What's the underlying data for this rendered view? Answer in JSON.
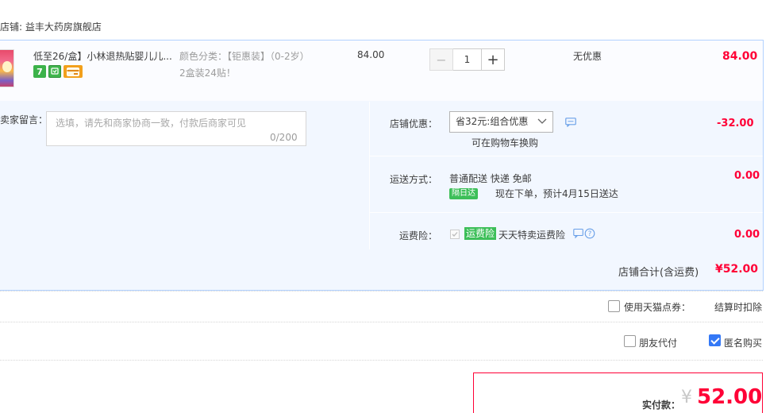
{
  "store": {
    "name_label": "店铺: 益丰大药房旗舰店"
  },
  "item": {
    "title": "低至26/盒】小林退热贴婴儿儿...",
    "badge_icons": [
      "tmall-7day-return-icon",
      "service-guarantee-icon",
      "card-payment-icon"
    ],
    "badge_seven_text": "7",
    "sku_line1": "颜色分类：【钜惠装】（0-2岁）",
    "sku_line2": "2盒装24贴！",
    "unit_price": "84.00",
    "quantity": "1",
    "qty_minus": "−",
    "qty_plus": "+",
    "discount_text": "无优惠",
    "subtotal": "84.00"
  },
  "message": {
    "label": "卖家留言：",
    "placeholder": "选填，请先和商家协商一致，付款后商家可见",
    "counter": "0/200"
  },
  "store_discount": {
    "label": "店铺优惠：",
    "selected": "省32元:组合优惠",
    "cart_swap": "可在购物车换购",
    "amount": "-32.00"
  },
  "shipping": {
    "label": "运送方式：",
    "method": "普通配送 快递 免邮",
    "next_day_badge": "隔日达",
    "eta": "现在下单，预计4月15日送达",
    "amount": "0.00"
  },
  "insurance": {
    "label": "运费险：",
    "badge": "运费险",
    "text": "天天特卖运费险",
    "amount": "0.00"
  },
  "store_total": {
    "label": "店铺合计(含运费)",
    "amount": "¥52.00"
  },
  "options": {
    "coupon_label": "使用天猫点券：",
    "settle_label": "结算时扣除",
    "friend_pay_label": "朋友代付",
    "anonymous_label": "匿名购买",
    "anonymous_checked": true,
    "friend_pay_checked": false,
    "coupon_checked": false
  },
  "payment": {
    "label": "实付款：",
    "currency": "¥",
    "amount": "52.00"
  },
  "colors": {
    "accent_red": "#ff0036",
    "panel_blue": "#f2f7ff",
    "green_badge": "#3dbf59",
    "checkbox_blue": "#3478f6"
  }
}
